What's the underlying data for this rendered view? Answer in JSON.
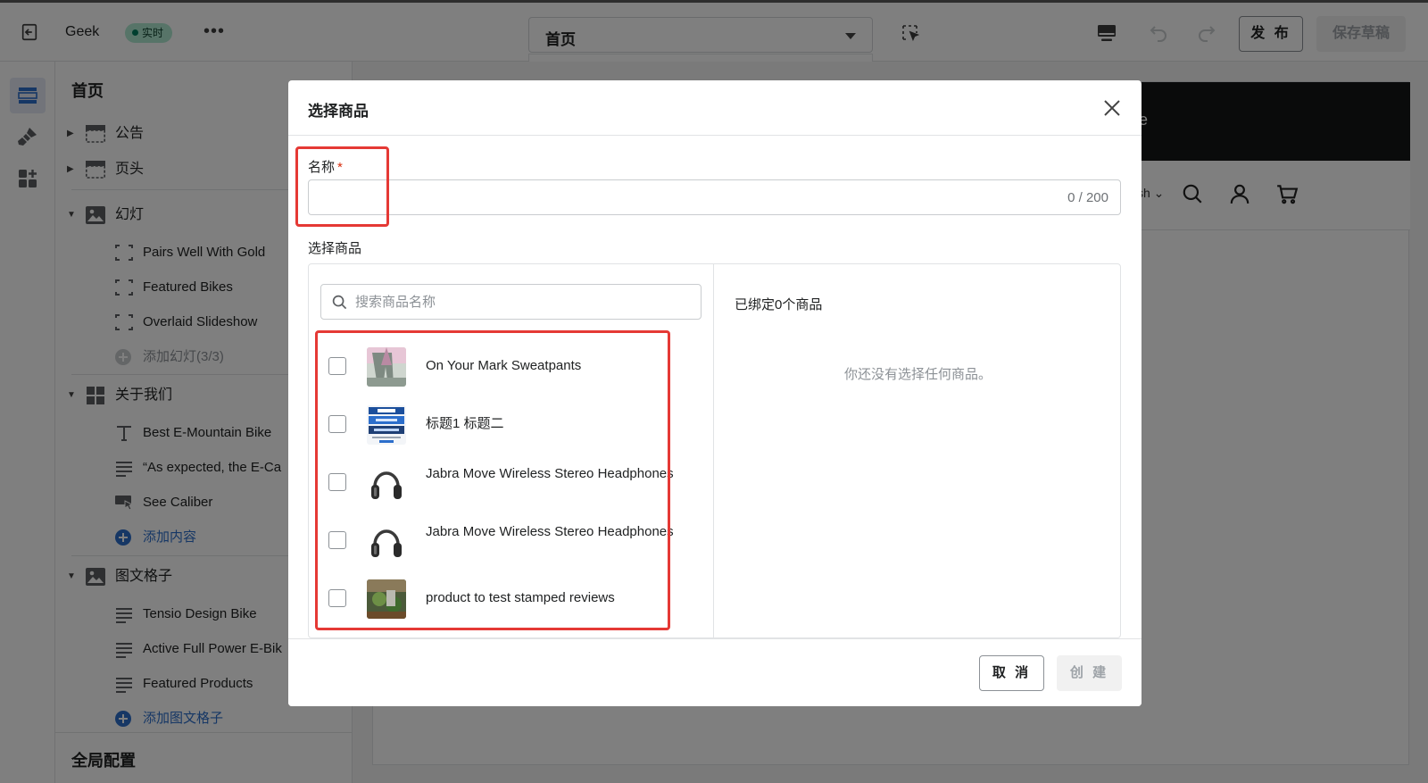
{
  "topbar": {
    "store_name": "Geek",
    "live_badge": "实时",
    "page_select": "首页",
    "publish_label": "发 布",
    "save_draft_label": "保存草稿"
  },
  "panel": {
    "title": "首页",
    "sections": [
      {
        "label": "公告",
        "icon": "header-bar-icon"
      },
      {
        "label": "页头",
        "icon": "header-bar-icon"
      },
      {
        "label": "幻灯",
        "icon": "image-icon",
        "items": [
          "Pairs Well With Gold",
          "Featured Bikes",
          "Overlaid Slideshow"
        ],
        "add": "添加幻灯(3/3)"
      },
      {
        "label": "关于我们",
        "icon": "grid-icon",
        "items": [
          "Best E-Mountain Bike",
          "“As expected, the E-Ca",
          "See Caliber"
        ],
        "add": "添加内容"
      },
      {
        "label": "图文格子",
        "icon": "image-icon",
        "items": [
          "Tensio Design Bike",
          "Active Full Power E-Bik",
          "Featured Products"
        ],
        "add": "添加图文格子"
      }
    ],
    "footer": "全局配置"
  },
  "preview": {
    "banner_text": "e",
    "lang_text": "sh"
  },
  "modal": {
    "title": "选择商品",
    "name_label": "名称",
    "required_mark": "*",
    "name_value": "",
    "name_count": "0 / 200",
    "select_label": "选择商品",
    "search_placeholder": "搜索商品名称",
    "products": [
      {
        "name": "On Your Mark Sweatpants",
        "thumb": "sweatpants-photo"
      },
      {
        "name": "标题1 标题二",
        "thumb": "paypal-card-image"
      },
      {
        "name": "Jabra Move Wireless Stereo Headphones",
        "thumb": "headphones-photo"
      },
      {
        "name": "Jabra Move Wireless Stereo Headphones",
        "thumb": "headphones-photo"
      },
      {
        "name": "product to test stamped reviews",
        "thumb": "garden-photo"
      }
    ],
    "bound_text": "已绑定0个商品",
    "empty_text": "你还没有选择任何商品。",
    "cancel_label": "取 消",
    "create_label": "创 建"
  },
  "colors": {
    "highlight": "#e53935",
    "accent": "#2c6ecb",
    "live_badge_bg": "#aee9d1"
  }
}
